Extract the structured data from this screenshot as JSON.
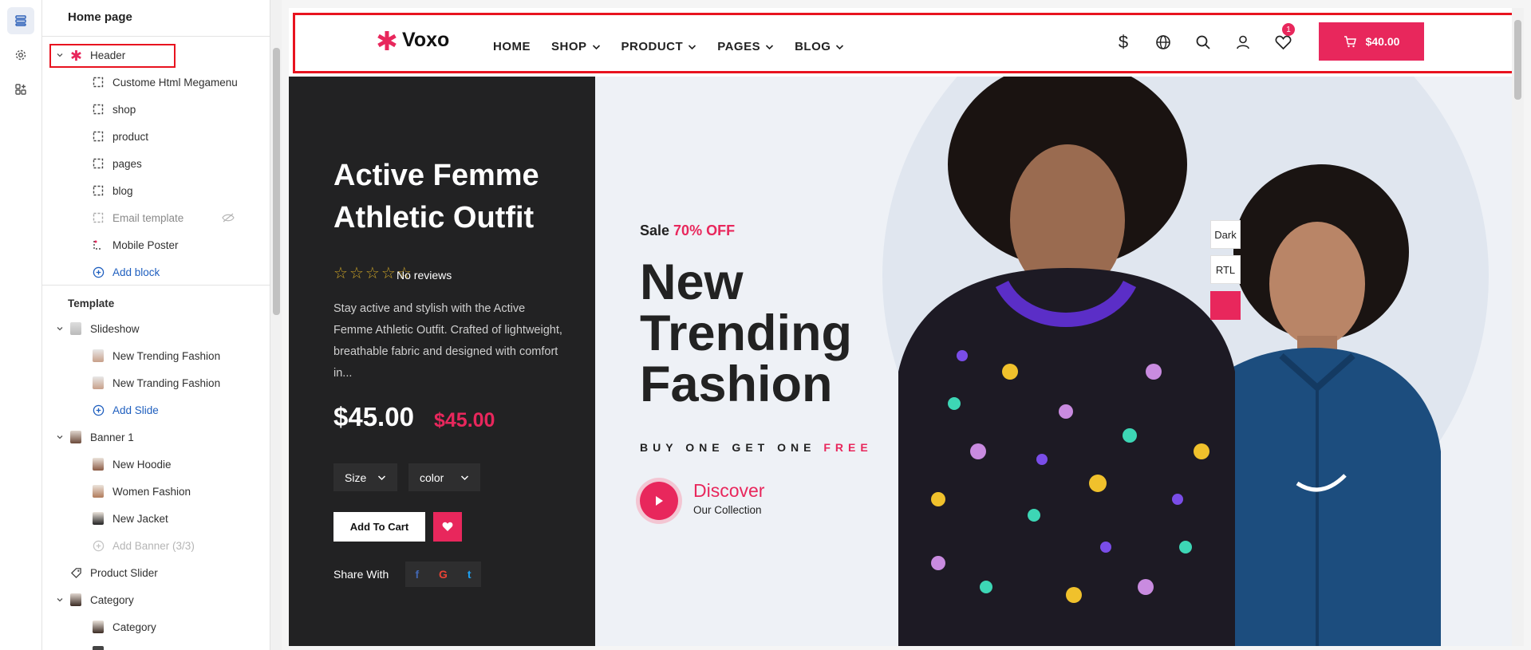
{
  "sidebar": {
    "title": "Home page",
    "header_group": {
      "label": "Header",
      "items": [
        {
          "label": "Custome Html Megamenu"
        },
        {
          "label": "shop"
        },
        {
          "label": "product"
        },
        {
          "label": "pages"
        },
        {
          "label": "blog"
        },
        {
          "label": "Email template"
        },
        {
          "label": "Mobile Poster"
        }
      ],
      "add_label": "Add block"
    },
    "template_label": "Template",
    "slideshow": {
      "label": "Slideshow",
      "items": [
        {
          "label": "New Trending Fashion"
        },
        {
          "label": "New Tranding Fashion"
        }
      ],
      "add_label": "Add Slide"
    },
    "banner": {
      "label": "Banner 1",
      "items": [
        {
          "label": "New Hoodie"
        },
        {
          "label": "Women Fashion"
        },
        {
          "label": "New Jacket"
        }
      ],
      "add_label": "Add Banner (3/3)"
    },
    "product_slider": {
      "label": "Product Slider"
    },
    "category": {
      "label": "Category",
      "items": [
        {
          "label": "Category"
        }
      ]
    }
  },
  "store": {
    "logo": "Voxo",
    "nav": [
      "HOME",
      "SHOP",
      "PRODUCT",
      "PAGES",
      "BLOG"
    ],
    "wishlist_count": "1",
    "cart_total": "$40.00"
  },
  "product": {
    "title": "Active Femme Athletic Outfit",
    "reviews": "No reviews",
    "description": "Stay active and stylish with the Active Femme Athletic Outfit. Crafted of lightweight, breathable fabric and designed with comfort in...",
    "price": "$45.00",
    "compare_price": "$45.00",
    "size_label": "Size",
    "color_label": "color",
    "add_to_cart": "Add To Cart",
    "share_label": "Share With",
    "share_icons": [
      "f",
      "G",
      "t"
    ]
  },
  "hero": {
    "sale_prefix": "Sale",
    "sale_off": "70% OFF",
    "title": "New Trending Fashion",
    "bogo_prefix": "BUY ONE GET ONE",
    "bogo_free": "FREE",
    "discover": "Discover",
    "collection": "Our Collection"
  },
  "tools": {
    "dark": "Dark",
    "rtl": "RTL"
  },
  "colors": {
    "accent": "#e8275c",
    "highlight": "#e8131f",
    "dark_panel": "#222223"
  }
}
